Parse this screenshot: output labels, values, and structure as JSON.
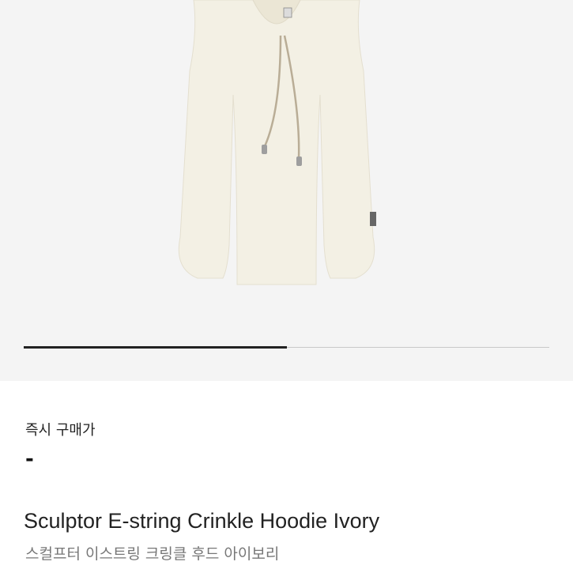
{
  "product": {
    "image_alt": "Sculptor E-string Crinkle Hoodie Ivory",
    "image_progress": 0.5,
    "label_buy_now": "즉시 구매가",
    "price": "-",
    "name_en": "Sculptor E-string Crinkle Hoodie Ivory",
    "name_ko": "스컬프터 이스트링 크링클 후드 아이보리"
  },
  "colors": {
    "image_bg": "#f4f4f4",
    "garment": "#f3f0e4",
    "drawstring": "#b9ad96",
    "progress_fill": "#222222",
    "progress_track": "#c8c8c8"
  }
}
